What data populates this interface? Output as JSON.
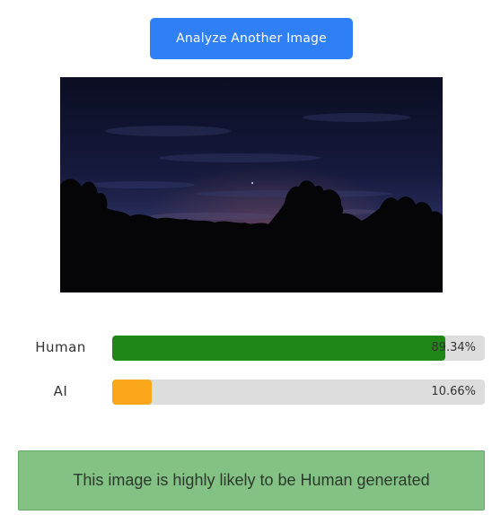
{
  "actions": {
    "analyze_label": "Analyze Another Image"
  },
  "preview": {
    "alt": "Uploaded image preview"
  },
  "results": [
    {
      "label": "Human",
      "percent": 89.34,
      "percent_text": "89.34%",
      "color": "#1e8716"
    },
    {
      "label": "AI",
      "percent": 10.66,
      "percent_text": "10.66%",
      "color": "#f9a61b"
    }
  ],
  "verdict": {
    "text": "This image is highly likely to be Human generated",
    "background": "#84c184"
  },
  "colors": {
    "button": "#2f80f7",
    "track": "#dddddd"
  }
}
